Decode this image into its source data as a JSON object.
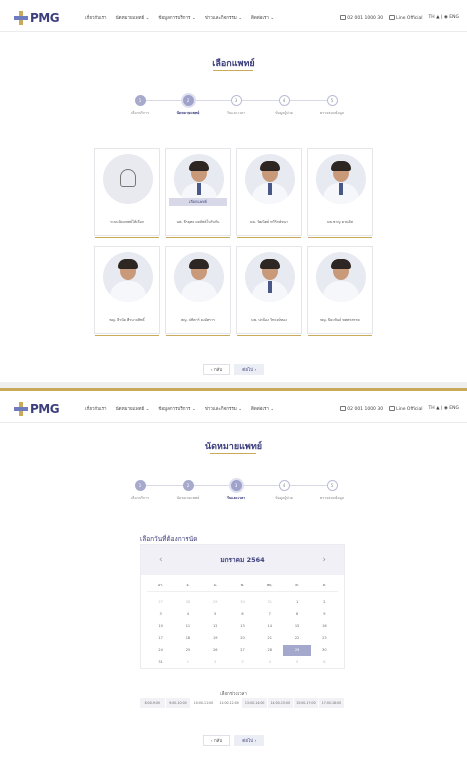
{
  "header": {
    "logo_text": "PMG",
    "menu": [
      "เกี่ยวกับเรา",
      "นัดหมายแพทย์ ⌄",
      "ข้อมูลการบริการ ⌄",
      "ข่าวและกิจกรรม ⌄",
      "ติดต่อเรา ⌄"
    ],
    "phone": "02 001 1000 30",
    "line_label": "Line Official",
    "lang": "TH ▲ | ◉ ENG"
  },
  "step_labels": [
    "เลือกบริการ",
    "นัดหมายแพทย์",
    "วันและเวลา",
    "ข้อมูลผู้ป่วย",
    "ตรวจสอบข้อมูล"
  ],
  "screen1": {
    "title": "เลือกแพทย์",
    "steps": [
      "1",
      "2",
      "3",
      "4",
      "5"
    ],
    "active_step": 1,
    "selected_badge": "เลือกแพทย์",
    "doctors": [
      {
        "name": "ระบบจัดแพทย์ให้เลือก",
        "generic": true
      },
      {
        "name": "นพ. ธีรยุทธ ผลลัพธ์ใบรับกัน",
        "selected": true
      },
      {
        "name": "นพ. วัฒนิตย์ ทวีรักษ์ชนา"
      },
      {
        "name": "นพ.ชาญ ควนดิส"
      },
      {
        "name": "พญ. ธีรนัย พีรนาถสิทธิ์"
      },
      {
        "name": "พญ. ปทิตาร์ ยงอัศราร"
      },
      {
        "name": "นพ. ปกป้อง วิทวงษ์ทอง"
      },
      {
        "name": "พญ. ปิยะพันธ์ ทศพรสรรค"
      }
    ],
    "back": "‹   กลับ",
    "next": "ต่อไป   ›"
  },
  "screen2": {
    "title": "นัดหมายแพทย์",
    "steps": [
      "1",
      "2",
      "3",
      "4",
      "5"
    ],
    "active_step": 2,
    "select_date_label": "เลือกวันที่ต้องการนัด",
    "month": "มกราคม   2564",
    "weekdays": [
      "อา.",
      "จ.",
      "อ.",
      "พ.",
      "พฤ.",
      "ศ.",
      "ส."
    ],
    "days": [
      [
        "27",
        "28",
        "29",
        "30",
        "31",
        "1",
        "2"
      ],
      [
        "3",
        "4",
        "5",
        "6",
        "7",
        "8",
        "9"
      ],
      [
        "10",
        "11",
        "12",
        "13",
        "14",
        "15",
        "16"
      ],
      [
        "17",
        "18",
        "19",
        "20",
        "21",
        "22",
        "23"
      ],
      [
        "24",
        "25",
        "26",
        "27",
        "28",
        "29",
        "30"
      ],
      [
        "31",
        "1",
        "2",
        "3",
        "4",
        "5",
        "6"
      ]
    ],
    "selected_day": "29",
    "time_label": "เลือกช่วงเวลา",
    "time_slots": [
      "8:00-9:00",
      "9:00-10:00",
      "10:00-11:00",
      "11:00-12:00",
      "13:00-14:00",
      "14:00-15:00",
      "15:00-17:00",
      "17:00-18:00"
    ],
    "back": "‹   กลับ",
    "next": "ต่อไป   ›"
  },
  "colors": {
    "brand": "#3d3f7d",
    "accent_gold": "#c9a95a",
    "active_step": "#9fa3cc"
  }
}
